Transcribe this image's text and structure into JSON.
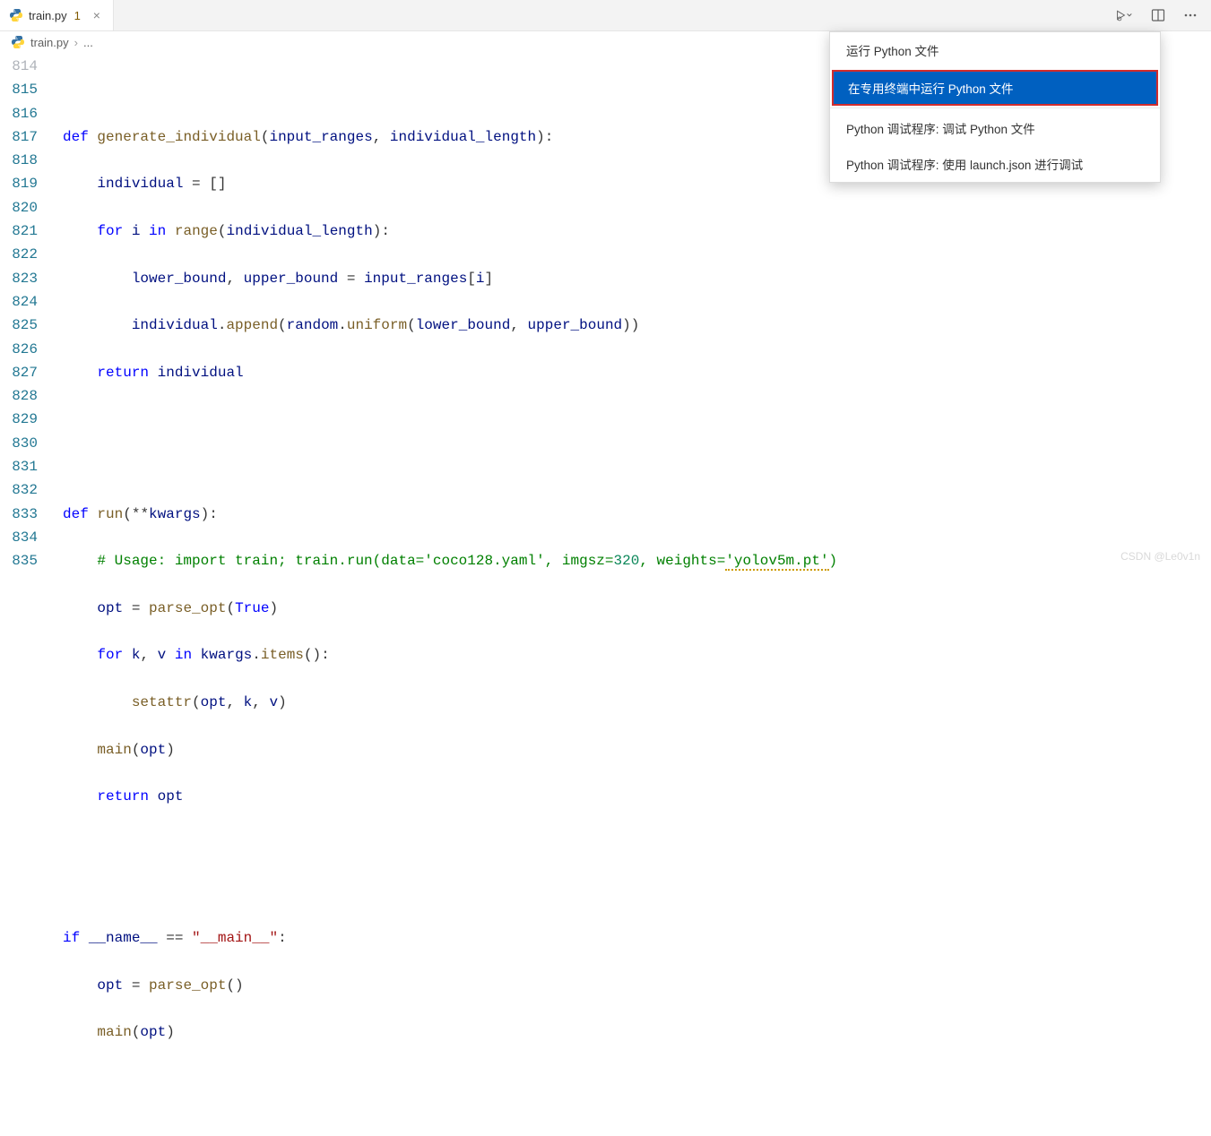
{
  "tab": {
    "filename": "train.py",
    "dirty_marker": "1",
    "close_symbol": "×"
  },
  "breadcrumb": {
    "filename": "train.py",
    "sep": "›",
    "more": "..."
  },
  "menu": {
    "items": [
      "运行 Python 文件",
      "在专用终端中运行 Python 文件",
      "Python 调试程序: 调试 Python 文件",
      "Python 调试程序: 使用 launch.json 进行调试"
    ],
    "selected_index": 1
  },
  "line_numbers": [
    "814",
    "815",
    "816",
    "817",
    "818",
    "819",
    "820",
    "821",
    "822",
    "823",
    "824",
    "825",
    "826",
    "827",
    "828",
    "829",
    "830",
    "831",
    "832",
    "833",
    "834",
    "835"
  ],
  "code": {
    "l815": {
      "def": "def",
      "fn": "generate_individual",
      "p1": "input_ranges",
      "p2": "individual_length"
    },
    "l816": {
      "var": "individual"
    },
    "l817": {
      "for": "for",
      "i": "i",
      "in": "in",
      "range": "range",
      "arg": "individual_length"
    },
    "l818": {
      "v1": "lower_bound",
      "v2": "upper_bound",
      "r": "input_ranges",
      "i": "i"
    },
    "l819": {
      "obj": "individual",
      "m": "append",
      "r1": "random",
      "r2": "uniform",
      "a1": "lower_bound",
      "a2": "upper_bound"
    },
    "l820": {
      "ret": "return",
      "v": "individual"
    },
    "l823": {
      "def": "def",
      "fn": "run",
      "kw": "kwargs"
    },
    "l824": {
      "c": "# Usage: import train; train.run(data=",
      "s1": "'coco128.yaml'",
      "c2": ", imgsz=",
      "n": "320",
      "c3": ", weights=",
      "s2": "'yolov5m.pt'",
      "c4": ")"
    },
    "l825": {
      "v": "opt",
      "fn": "parse_opt",
      "t": "True"
    },
    "l826": {
      "for": "for",
      "k": "k",
      "v": "v",
      "in": "in",
      "o": "kwargs",
      "m": "items"
    },
    "l827": {
      "fn": "setattr",
      "a1": "opt",
      "a2": "k",
      "a3": "v"
    },
    "l828": {
      "fn": "main",
      "a": "opt"
    },
    "l829": {
      "ret": "return",
      "v": "opt"
    },
    "l832": {
      "if": "if",
      "name": "__name__",
      "eq": "==",
      "main": "\"__main__\""
    },
    "l833": {
      "v": "opt",
      "fn": "parse_opt"
    },
    "l834": {
      "fn": "main",
      "a": "opt"
    }
  },
  "watermark": "CSDN @Le0v1n"
}
